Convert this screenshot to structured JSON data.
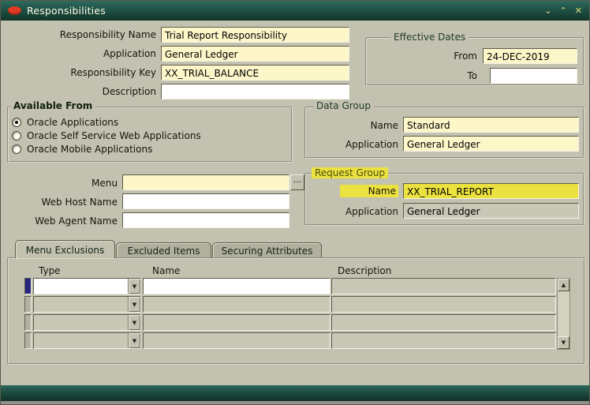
{
  "titlebar": {
    "title": "Responsibilities"
  },
  "icons": {
    "minimize": "⌄",
    "restore": "⌃",
    "close": "✕",
    "combo_arrow": "▼",
    "scroll_up": "▲",
    "scroll_down": "▼"
  },
  "fields": {
    "responsibility_name": {
      "label": "Responsibility Name",
      "value": "Trial Report Responsibility"
    },
    "application": {
      "label": "Application",
      "value": "General Ledger"
    },
    "responsibility_key": {
      "label": "Responsibility Key",
      "value": "XX_TRIAL_BALANCE"
    },
    "description": {
      "label": "Description",
      "value": ""
    }
  },
  "effective_dates": {
    "title": "Effective Dates",
    "from_label": "From",
    "from_value": "24-DEC-2019",
    "to_label": "To",
    "to_value": ""
  },
  "available_from": {
    "title": "Available From",
    "options": [
      {
        "label": "Oracle Applications",
        "selected": true
      },
      {
        "label": "Oracle Self Service Web Applications",
        "selected": false
      },
      {
        "label": "Oracle Mobile Applications",
        "selected": false
      }
    ]
  },
  "data_group": {
    "title": "Data Group",
    "name_label": "Name",
    "name_value": "Standard",
    "application_label": "Application",
    "application_value": "General Ledger"
  },
  "menu_section": {
    "menu_label": "Menu",
    "menu_value": "",
    "lov_button": "...",
    "web_host_label": "Web Host Name",
    "web_host_value": "",
    "web_agent_label": "Web Agent Name",
    "web_agent_value": ""
  },
  "request_group": {
    "title": "Request Group",
    "name_label": "Name",
    "name_value": "XX_TRIAL_REPORT",
    "application_label": "Application",
    "application_value": "General Ledger"
  },
  "tabs": [
    {
      "label": "Menu Exclusions",
      "active": true
    },
    {
      "label": "Excluded Items",
      "active": false
    },
    {
      "label": "Securing Attributes",
      "active": false
    }
  ],
  "exclusions": {
    "columns": [
      "Type",
      "Name",
      "Description"
    ],
    "rows": [
      {
        "type": "",
        "name": "",
        "description": ""
      },
      {
        "type": "",
        "name": "",
        "description": ""
      },
      {
        "type": "",
        "name": "",
        "description": ""
      },
      {
        "type": "",
        "name": "",
        "description": ""
      }
    ]
  },
  "colors": {
    "titlebar_green": "#1d4b40",
    "canvas": "#c3c1b0",
    "required_field_yellow": "#fdf6c9",
    "highlight_marker": "#ece23f",
    "oracle_red": "#e23a24",
    "current_record_blue": "#26267c"
  }
}
